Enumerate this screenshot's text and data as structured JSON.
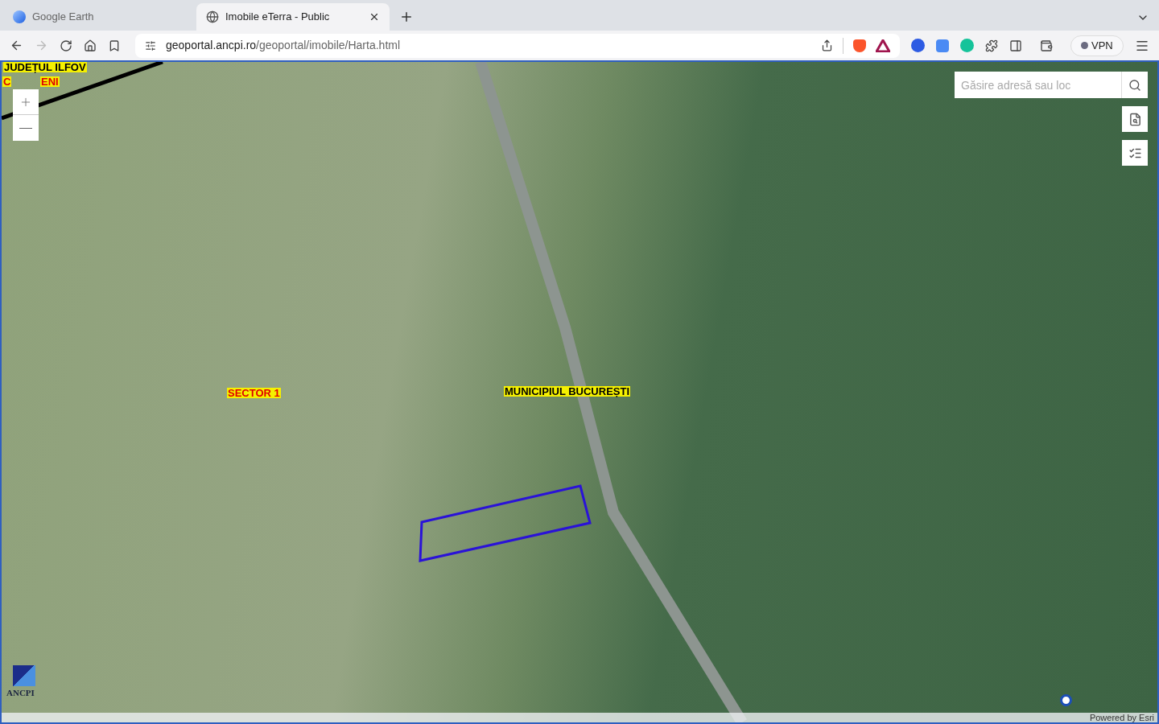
{
  "tabs": [
    {
      "title": "Google Earth",
      "selected": false
    },
    {
      "title": "Imobile eTerra - Public",
      "selected": true
    }
  ],
  "address_bar": {
    "host": "geoportal.ancpi.ro",
    "path": "/geoportal/imobile/Harta.html"
  },
  "toolbar": {
    "vpn_label": "VPN"
  },
  "map": {
    "search": {
      "placeholder": "Găsire adresă sau loc"
    },
    "labels": [
      {
        "text": "JUDEȚUL ILFOV",
        "kind": "county"
      },
      {
        "text": "C",
        "kind": "locality"
      },
      {
        "text": "ENI",
        "kind": "locality"
      },
      {
        "text": "SECTOR 1",
        "kind": "locality"
      },
      {
        "text": "MUNICIPIUL BUCUREȘTI",
        "kind": "county"
      }
    ],
    "logo_text": "ANCPI",
    "attribution": "Powered by Esri"
  }
}
